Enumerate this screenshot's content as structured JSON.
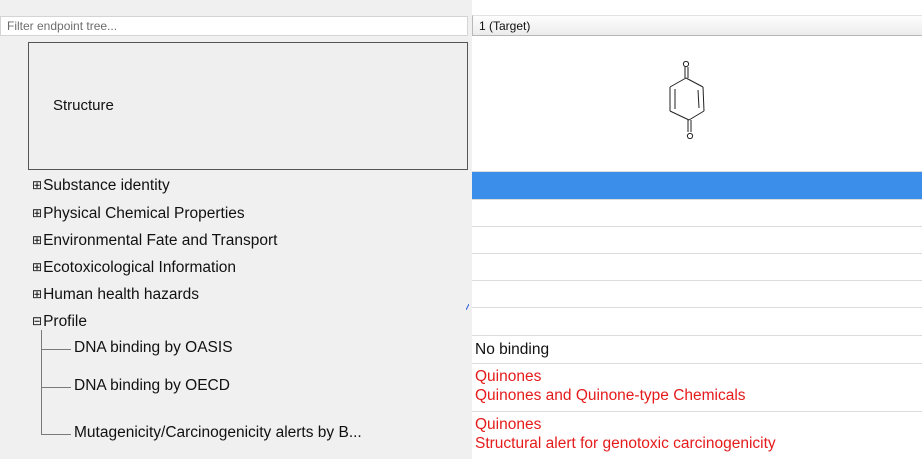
{
  "filter": {
    "placeholder": "Filter endpoint tree..."
  },
  "column_header": "1 (Target)",
  "structure": {
    "label": "Structure",
    "molecule_name": "1,4-benzoquinone",
    "atom_labels": [
      "O",
      "O"
    ]
  },
  "tree": {
    "expand_glyph": "⊞",
    "collapse_glyph": "⊟",
    "categories": [
      "Substance identity",
      "Physical Chemical Properties",
      "Environmental Fate and Transport",
      "Ecotoxicological Information",
      "Human health hazards"
    ],
    "profile": {
      "label": "Profile",
      "children": [
        "DNA binding by OASIS",
        "DNA binding by OECD",
        "Mutagenicity/Carcinogenicity alerts by B..."
      ]
    }
  },
  "values": {
    "dna_oasis": "No binding",
    "dna_oecd": [
      "Quinones",
      "Quinones and Quinone-type Chemicals"
    ],
    "mutagenicity": [
      "Quinones",
      "Structural alert for genotoxic carcinogenicity"
    ]
  },
  "colors": {
    "selection": "#3b8fea",
    "alert_text": "#e51b1b"
  }
}
